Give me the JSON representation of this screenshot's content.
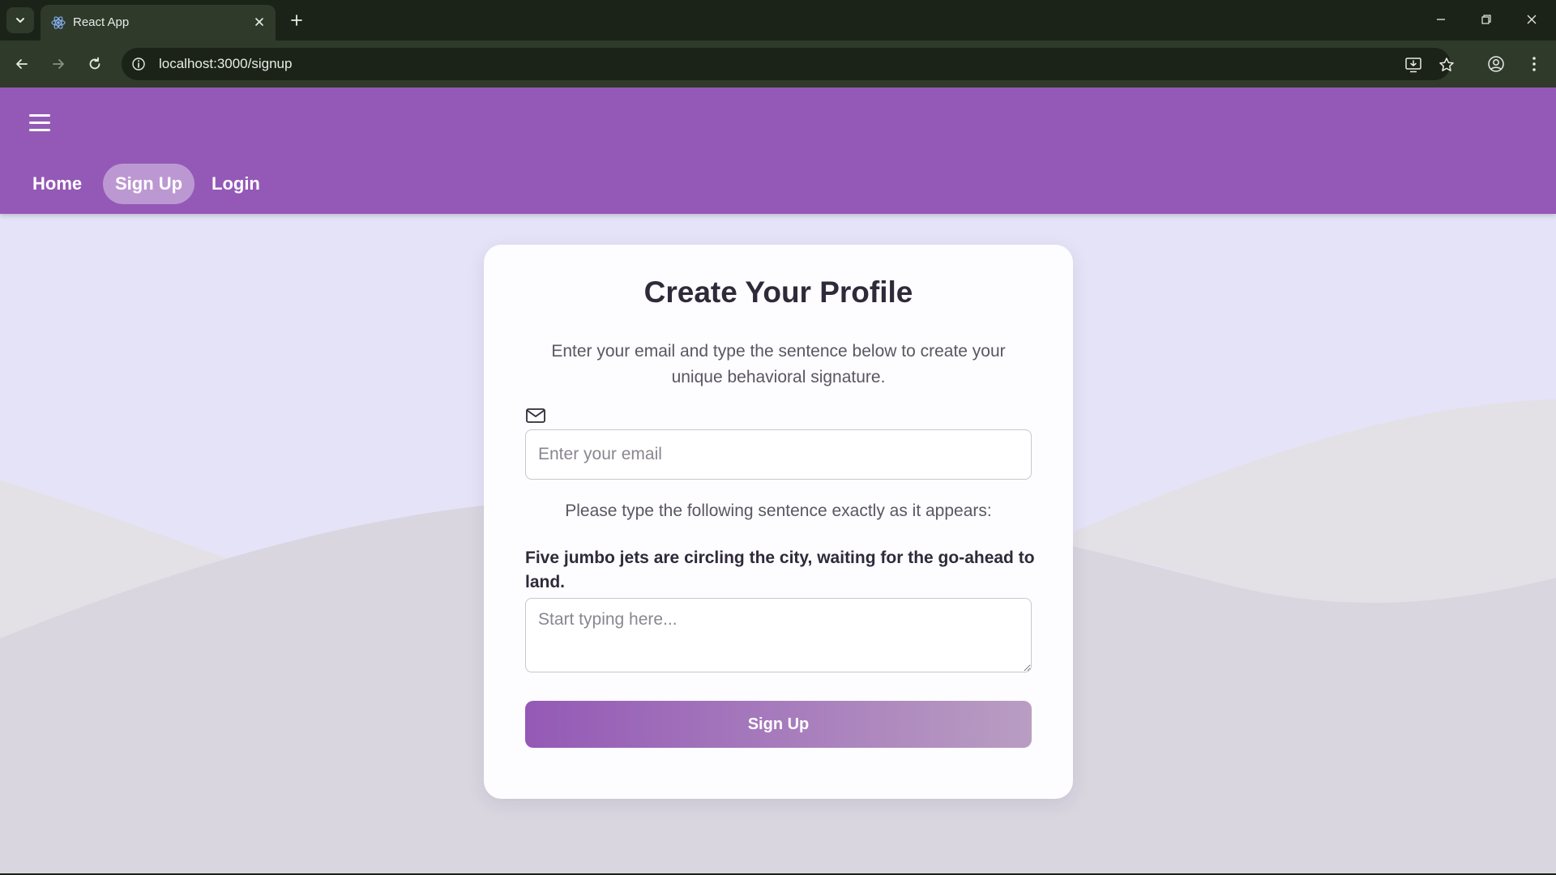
{
  "browser": {
    "tab_title": "React App",
    "url": "localhost:3000/signup"
  },
  "icons": {
    "tab_list": "chevron-down-icon",
    "favicon": "react-icon",
    "tab_close": "close-icon",
    "new_tab": "plus-icon",
    "back": "back-arrow-icon",
    "forward": "forward-arrow-icon",
    "reload": "reload-icon",
    "site_info": "info-icon",
    "install": "install-app-icon",
    "bookmark": "star-icon",
    "profile": "profile-icon",
    "menu": "kebab-menu-icon",
    "hamburger": "hamburger-menu-icon",
    "email": "mail-icon"
  },
  "nav": {
    "links": [
      {
        "label": "Home",
        "active": false
      },
      {
        "label": "Sign Up",
        "active": true
      },
      {
        "label": "Login",
        "active": false
      }
    ]
  },
  "signup": {
    "title": "Create Your Profile",
    "subtitle": "Enter your email and type the sentence below to create your unique behavioral signature.",
    "email_placeholder": "Enter your email",
    "email_value": "",
    "prompt": "Please type the following sentence exactly as it appears:",
    "sentence": "Five jumbo jets are circling the city, waiting for the go-ahead to land.",
    "typing_placeholder": "Start typing here...",
    "typing_value": "",
    "submit_label": "Sign Up"
  },
  "colors": {
    "appbar": "#9459b6",
    "page_background": "#e5e3f7",
    "button_gradient_start": "#9459b6",
    "button_gradient_end": "#b99dc2",
    "browser_frame": "#1b2318"
  }
}
